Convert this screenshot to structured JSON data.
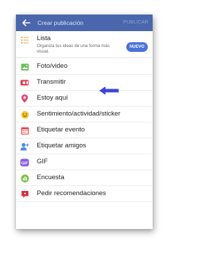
{
  "header": {
    "back_icon": "arrow-left-icon",
    "title": "Crear publicación",
    "action_label": "PUBLICAR",
    "background": "#4a66ad"
  },
  "lista": {
    "icon": "list-icon",
    "title": "Lista",
    "description": "Organiza tus ideas de una forma más visual.",
    "badge": "NUEVO",
    "badge_color": "#4a72d9"
  },
  "menu": {
    "items": [
      {
        "label": "Foto/video",
        "icon": "photo-icon",
        "color": "#6bbf5a"
      },
      {
        "label": "Transmitir",
        "icon": "video-camera-icon",
        "color": "#e0394e"
      },
      {
        "label": "Estoy aquí",
        "icon": "location-pin-icon",
        "color": "#e24a7a"
      },
      {
        "label": "Sentimiento/actividad/sticker",
        "icon": "smiley-icon",
        "color": "#f4c534"
      },
      {
        "label": "Etiquetar evento",
        "icon": "calendar-icon",
        "color": "#e34b50"
      },
      {
        "label": "Etiquetar amigos",
        "icon": "person-add-icon",
        "color": "#4b8fe0"
      },
      {
        "label": "GIF",
        "icon": "gif-icon",
        "color": "#8a5fe0"
      },
      {
        "label": "Encuesta",
        "icon": "poll-icon",
        "color": "#7cbf4a"
      },
      {
        "label": "Pedir recomendaciones",
        "icon": "speech-bubble-icon",
        "color": "#d9323f"
      }
    ]
  },
  "annotation": {
    "icon": "arrow-left-pointer-icon",
    "color": "#3d46d6"
  }
}
